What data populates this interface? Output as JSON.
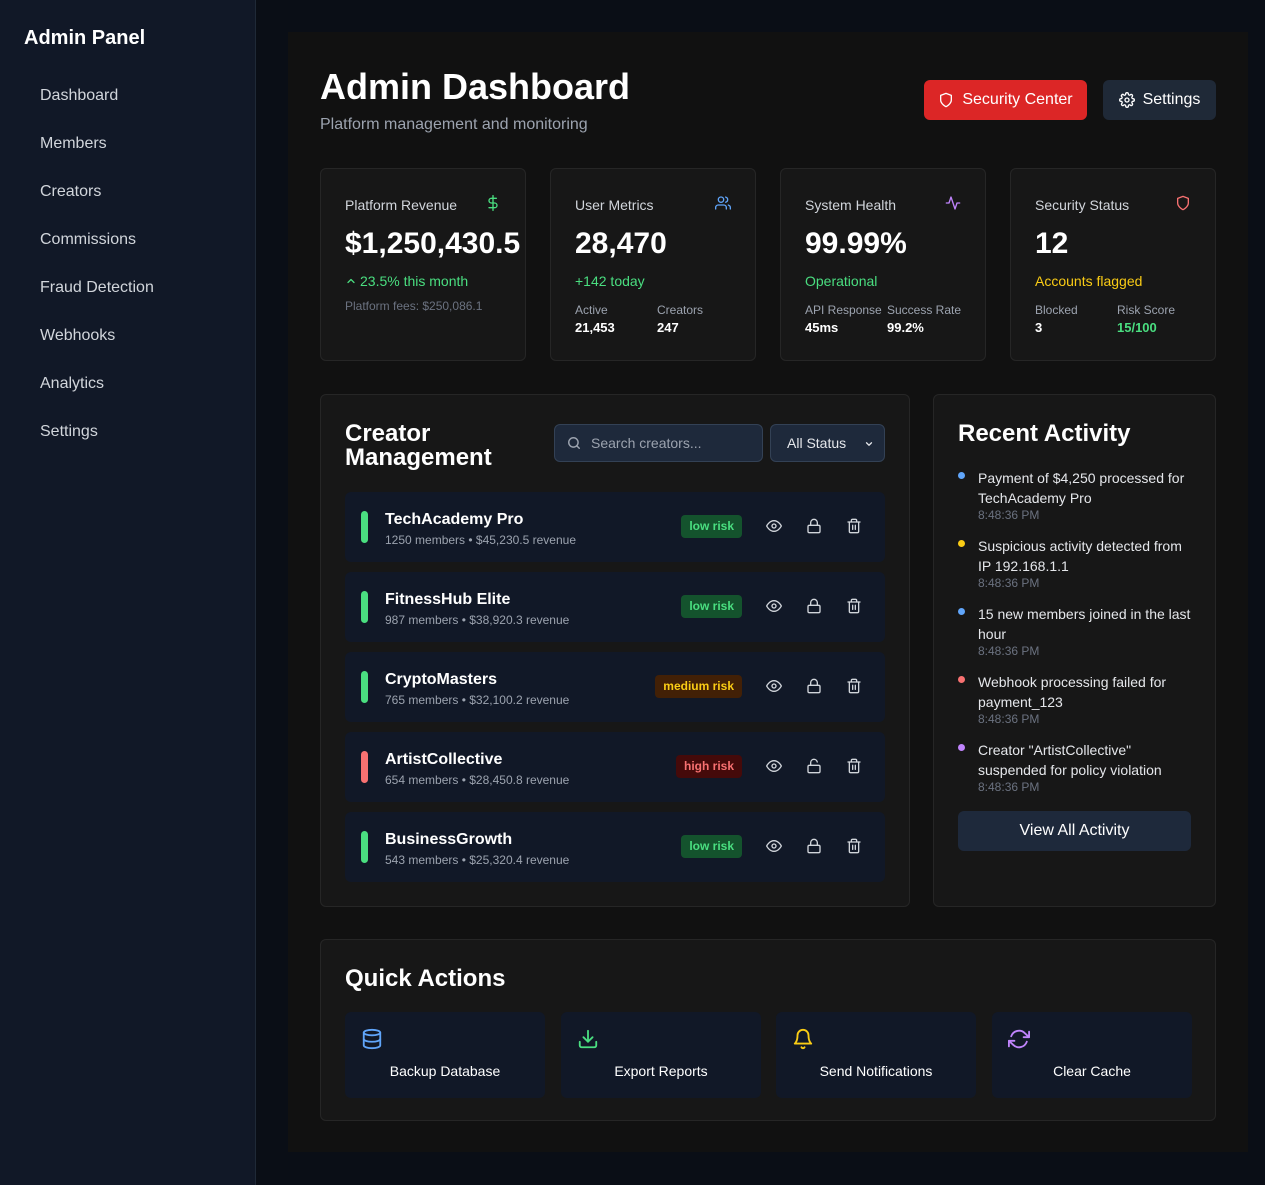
{
  "sidebar": {
    "brand": "Admin Panel",
    "items": [
      {
        "label": "Dashboard"
      },
      {
        "label": "Members"
      },
      {
        "label": "Creators"
      },
      {
        "label": "Commissions"
      },
      {
        "label": "Fraud Detection"
      },
      {
        "label": "Webhooks"
      },
      {
        "label": "Analytics"
      },
      {
        "label": "Settings"
      }
    ]
  },
  "header": {
    "title": "Admin Dashboard",
    "subtitle": "Platform management and monitoring",
    "security_button": "Security Center",
    "settings_button": "Settings"
  },
  "stats": {
    "revenue": {
      "label": "Platform Revenue",
      "value": "$1,250,430.5",
      "change": "23.5% this month",
      "note": "Platform fees: $250,086.1"
    },
    "users": {
      "label": "User Metrics",
      "value": "28,470",
      "sub": "+142 today",
      "m1_label": "Active",
      "m1_value": "21,453",
      "m2_label": "Creators",
      "m2_value": "247"
    },
    "health": {
      "label": "System Health",
      "value": "99.99%",
      "sub": "Operational",
      "m1_label": "API Response",
      "m1_value": "45ms",
      "m2_label": "Success Rate",
      "m2_value": "99.2%"
    },
    "security": {
      "label": "Security Status",
      "value": "12",
      "sub": "Accounts flagged",
      "m1_label": "Blocked",
      "m1_value": "3",
      "m2_label": "Risk Score",
      "m2_value": "15/100"
    }
  },
  "creators": {
    "title_line1": "Creator",
    "title_line2": "Management",
    "search_placeholder": "Search creators...",
    "status_filter": "All Status",
    "rows": [
      {
        "name": "TechAcademy Pro",
        "meta": "1250 members • $45,230.5 revenue",
        "risk": "low risk"
      },
      {
        "name": "FitnessHub Elite",
        "meta": "987 members • $38,920.3 revenue",
        "risk": "low risk"
      },
      {
        "name": "CryptoMasters",
        "meta": "765 members • $32,100.2 revenue",
        "risk": "medium risk"
      },
      {
        "name": "ArtistCollective",
        "meta": "654 members • $28,450.8 revenue",
        "risk": "high risk"
      },
      {
        "name": "BusinessGrowth",
        "meta": "543 members • $25,320.4 revenue",
        "risk": "low risk"
      }
    ]
  },
  "activity": {
    "title": "Recent Activity",
    "items": [
      {
        "text": "Payment of $4,250 processed for TechAcademy Pro",
        "time": "8:48:36 PM"
      },
      {
        "text": "Suspicious activity detected from IP 192.168.1.1",
        "time": "8:48:36 PM"
      },
      {
        "text": "15 new members joined in the last hour",
        "time": "8:48:36 PM"
      },
      {
        "text": "Webhook processing failed for payment_123",
        "time": "8:48:36 PM"
      },
      {
        "text": "Creator \"ArtistCollective\" suspended for policy violation",
        "time": "8:48:36 PM"
      }
    ],
    "view_all": "View All Activity"
  },
  "quick_actions": {
    "title": "Quick Actions",
    "items": [
      {
        "label": "Backup Database",
        "icon": "database-icon"
      },
      {
        "label": "Export Reports",
        "icon": "download-icon"
      },
      {
        "label": "Send Notifications",
        "icon": "bell-icon"
      },
      {
        "label": "Clear Cache",
        "icon": "refresh-icon"
      }
    ]
  },
  "colors": {
    "accent_red": "#dc2626",
    "green": "#4ade80",
    "yellow": "#facc15",
    "blue": "#60a5fa",
    "red": "#f87171",
    "purple": "#c084fc"
  }
}
